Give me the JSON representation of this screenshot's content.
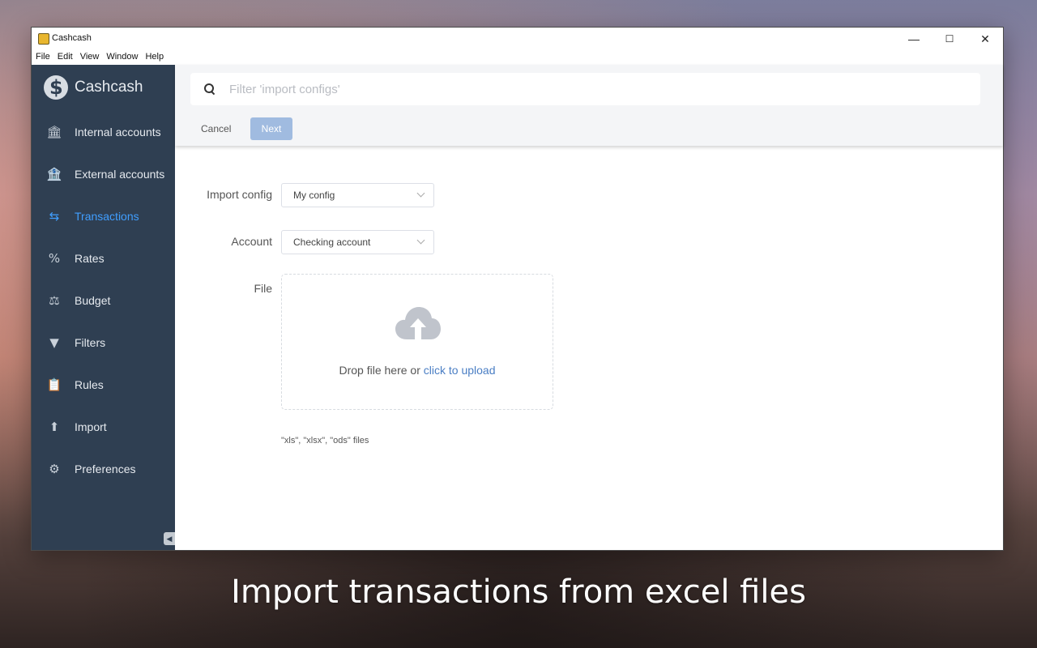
{
  "window": {
    "title": "Cashcash",
    "minimize_glyph": "—",
    "maximize_glyph": "☐",
    "close_glyph": "✕"
  },
  "menu": [
    "File",
    "Edit",
    "View",
    "Window",
    "Help"
  ],
  "sidebar": {
    "brand": "Cashcash",
    "items": [
      {
        "label": "Internal accounts",
        "icon": "bank-icon",
        "glyph": "🏛"
      },
      {
        "label": "External accounts",
        "icon": "external-bank-icon",
        "glyph": "🏦"
      },
      {
        "label": "Transactions",
        "icon": "swap-arrows-icon",
        "glyph": "⇆",
        "active": true
      },
      {
        "label": "Rates",
        "icon": "percent-icon",
        "glyph": "%"
      },
      {
        "label": "Budget",
        "icon": "scale-icon",
        "glyph": "⚖"
      },
      {
        "label": "Filters",
        "icon": "filter-funnel-icon",
        "glyph": "▼"
      },
      {
        "label": "Rules",
        "icon": "clipboard-icon",
        "glyph": "📋"
      },
      {
        "label": "Import",
        "icon": "file-import-icon",
        "glyph": "⬆"
      },
      {
        "label": "Preferences",
        "icon": "gear-icon",
        "glyph": "⚙"
      }
    ],
    "collapse_glyph": "◀"
  },
  "search": {
    "placeholder": "Filter 'import configs'",
    "value": ""
  },
  "toolbar": {
    "cancel_label": "Cancel",
    "next_label": "Next"
  },
  "form": {
    "import_config_label": "Import config",
    "import_config_value": "My config",
    "account_label": "Account",
    "account_value": "Checking account",
    "file_label": "File",
    "drop_text": "Drop file here or ",
    "upload_link": "click to upload",
    "hint": "\"xls\", \"xlsx\", \"ods\" files"
  },
  "caption": "Import transactions from excel files",
  "colors": {
    "sidebar_bg": "#2f3f52",
    "active": "#409eff",
    "next_button": "#a0bbe0"
  }
}
